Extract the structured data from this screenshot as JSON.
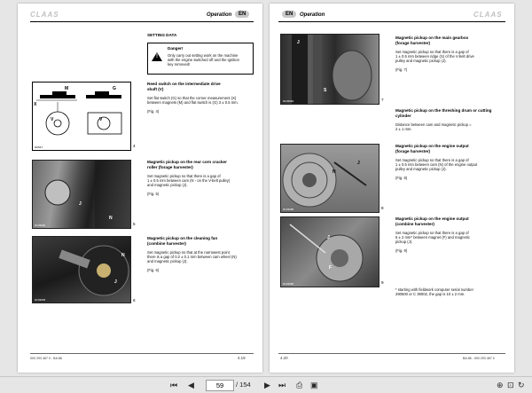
{
  "left_page": {
    "logo": "CLAAS",
    "header_title": "Operation",
    "header_lang": "EN",
    "section_title": "SETTING DATA",
    "danger_title": "Danger!",
    "danger_text": [
      "Only carry out setting work on the machine",
      "with the engine switched off and the ignition",
      "key removed!"
    ],
    "blocks": [
      {
        "title": [
          "Reed switch on the intermediate drive",
          "shaft (V)"
        ],
        "body": [
          "Set flat switch (G) so that the corner measurement (X)",
          "between magnets (M) and flat switch is (G) 3 ± 0.5 mm."
        ],
        "fig": "(Fig. 4)",
        "figno": "4",
        "photo_code": "9G547"
      },
      {
        "title": [
          "Magnetic pickup on the rear corn cracker",
          "roller (forage harvester)"
        ],
        "body": [
          "Set magnetic pickup so that there is a gap of",
          "1 ± 0.5 mm between cam (N - on the V-belt pulley)",
          "and magnetic pickup (J)."
        ],
        "fig": "(Fig. 5)",
        "figno": "5",
        "photo_code": "9C33684"
      },
      {
        "title": [
          "Magnetic pickup on the cleaning fan",
          "(combine harvester)"
        ],
        "body": [
          "Set magnetic pickup so that at the narrowest point",
          "there is a gap of 0.2 ± 0.1 mm between cam wheel (N)",
          "and magnetic pickup (J)."
        ],
        "fig": "(Fig. 6)",
        "figno": "6",
        "photo_code": "9C33945"
      }
    ],
    "footer_code": "000 293 467 0 - BA 88",
    "page_number": "4.19"
  },
  "right_page": {
    "logo": "CLAAS",
    "header_title": "Operation",
    "header_lang": "EN",
    "blocks": [
      {
        "title": [
          "Magnetic pickup on the main gearbox",
          "(forage harvester)"
        ],
        "body": [
          "Set magnetic pickup so that there is a gap of",
          "1 ± 0.5 mm between ridge (S) of the V-belt drive",
          "pulley and magnetic pickup (J)."
        ],
        "fig": "(Fig. 7)",
        "figno": "7",
        "photo_code": "9C33684"
      },
      {
        "title": [
          "Magnetic pickup on the threshing drum or cutting",
          "cylinder"
        ],
        "body": [
          "Distance between cam and magnetic pickup =",
          "2 ± 1 mm."
        ],
        "fig": "",
        "figno": "",
        "photo_code": ""
      },
      {
        "title": [
          "Magnetic pickup on the engine output",
          "(forage harvester)"
        ],
        "body": [
          "Set magnetic pickup so that there is a gap of",
          "1 ± 0.5 mm between cam (N) of the engine output",
          "pulley and magnetic pickup (J)."
        ],
        "fig": "(Fig. 8)",
        "figno": "8",
        "photo_code": "9C33685"
      },
      {
        "title": [
          "Magnetic pickup on the engine output",
          "(combine harvester)"
        ],
        "body": [
          "Set magnetic pickup so that there is a gap of",
          "6 ± 2 mm* between magnet (F) and magnetic",
          "pickup (J)."
        ],
        "fig": "(Fig. 9)",
        "figno": "9",
        "photo_code": "9C33686"
      }
    ],
    "footnote": [
      "* starting with fieldwork computer serial number",
      "290500 or C 39002, the gap is 10 ± 2 mm."
    ],
    "footer_code": "BA 88 - 000 293 467 0",
    "page_number": "4.20"
  },
  "toolbar": {
    "current_page": "59",
    "total_pages": "/ 154",
    "first": "⏮",
    "prev": "◀",
    "next": "▶",
    "last": "⏭",
    "icons": [
      "print-icon",
      "save-icon",
      "zoom-icon",
      "fit-icon",
      "rotate-icon",
      "pages-icon",
      "settings-icon"
    ]
  },
  "colors": {
    "badge": "#c8c8c8",
    "logo": "#c0c0c0",
    "toolbar": "#e6e6e6"
  }
}
